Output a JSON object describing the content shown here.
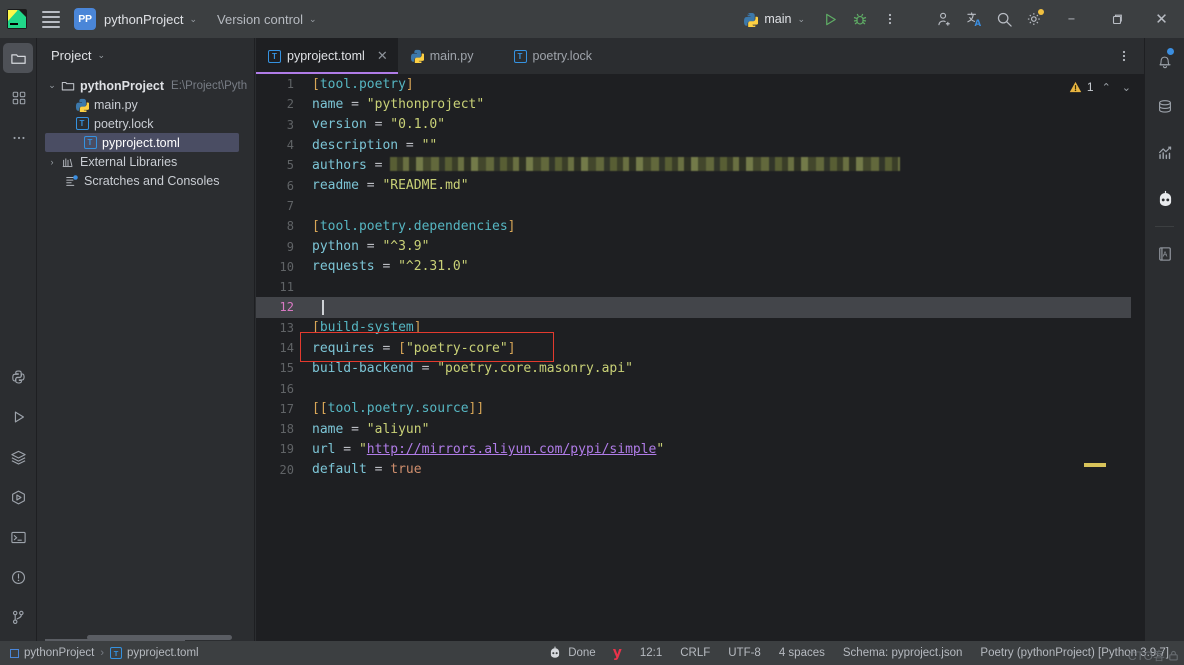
{
  "titlebar": {
    "app_icon": "pycharm-logo-icon",
    "menu_icon": "hamburger-menu-icon",
    "project_badge": "PP",
    "project_name": "pythonProject",
    "project_chevron": "⌄",
    "version_control": "Version control",
    "vcs_chevron": "⌄",
    "run_config": "main",
    "run_config_chevron": "⌄",
    "run_icon": "run-triangle-icon",
    "debug_icon": "debug-bug-icon",
    "more_icon": "more-vertical-icon",
    "account_icon": "add-user-icon",
    "translate_icon": "translate-icon",
    "search_icon": "search-icon",
    "settings_icon": "gear-icon",
    "minimize": "−",
    "maximize": "❐",
    "close": "✕"
  },
  "left_rail": {
    "items": [
      {
        "name": "project-tool-window",
        "icon": "folder-icon",
        "active": true
      },
      {
        "name": "structure-tool-window",
        "icon": "structure-icon",
        "active": false
      },
      {
        "name": "more-tool-windows",
        "icon": "ellipsis-icon",
        "active": false
      }
    ],
    "bottom_items": [
      {
        "name": "python-packages",
        "icon": "python-icon"
      },
      {
        "name": "run-tool-window",
        "icon": "run-triangle-icon"
      },
      {
        "name": "services-tool-window",
        "icon": "layers-icon"
      },
      {
        "name": "python-console",
        "icon": "hexagon-play-icon"
      },
      {
        "name": "terminal-tool-window",
        "icon": "terminal-icon"
      },
      {
        "name": "problems-tool-window",
        "icon": "exclamation-circle-icon"
      },
      {
        "name": "version-control-tool-window",
        "icon": "git-branch-icon"
      }
    ]
  },
  "project_panel": {
    "header": "Project",
    "header_chevron": "⌄",
    "tree": [
      {
        "label": "pythonProject",
        "path": "E:\\Project\\Pyth",
        "icon": "folder-icon",
        "expanded": true,
        "indent": 0,
        "selected": false,
        "bold": true
      },
      {
        "label": "main.py",
        "path": "",
        "icon": "python-file-icon",
        "expanded": null,
        "indent": 1,
        "selected": false,
        "bold": false
      },
      {
        "label": "poetry.lock",
        "path": "",
        "icon": "toml-file-icon",
        "expanded": null,
        "indent": 1,
        "selected": false,
        "bold": false
      },
      {
        "label": "pyproject.toml",
        "path": "",
        "icon": "toml-file-icon",
        "expanded": null,
        "indent": 1,
        "selected": true,
        "bold": false
      },
      {
        "label": "External Libraries",
        "path": "",
        "icon": "library-icon",
        "expanded": false,
        "indent": 0,
        "selected": false,
        "bold": false
      },
      {
        "label": "Scratches and Consoles",
        "path": "",
        "icon": "scratches-icon",
        "expanded": null,
        "indent": 0,
        "selected": false,
        "bold": false
      }
    ]
  },
  "editor": {
    "tabs": [
      {
        "label": "pyproject.toml",
        "icon": "toml-file-icon",
        "active": true,
        "closable": true
      },
      {
        "label": "main.py",
        "icon": "python-file-icon",
        "active": false,
        "closable": false
      },
      {
        "label": "poetry.lock",
        "icon": "toml-file-icon",
        "active": false,
        "closable": false
      }
    ],
    "tab_close_glyph": "✕",
    "tabbar_more_icon": "more-vertical-icon",
    "inspection": {
      "warning_icon": "warning-triangle-icon",
      "warning_count": "1",
      "prev_glyph": "⌃",
      "next_glyph": "⌄"
    },
    "current_line": 12,
    "lines": [
      {
        "num": 1,
        "tokens": [
          {
            "t": "brk",
            "v": "["
          },
          {
            "t": "tbl",
            "v": "tool.poetry"
          },
          {
            "t": "brk",
            "v": "]"
          }
        ]
      },
      {
        "num": 2,
        "tokens": [
          {
            "t": "key",
            "v": "name"
          },
          {
            "t": "op",
            "v": " = "
          },
          {
            "t": "str",
            "v": "\"pythonproject\""
          }
        ]
      },
      {
        "num": 3,
        "tokens": [
          {
            "t": "key",
            "v": "version"
          },
          {
            "t": "op",
            "v": " = "
          },
          {
            "t": "str",
            "v": "\"0.1.0\""
          }
        ]
      },
      {
        "num": 4,
        "tokens": [
          {
            "t": "key",
            "v": "description"
          },
          {
            "t": "op",
            "v": " = "
          },
          {
            "t": "str",
            "v": "\"\""
          }
        ]
      },
      {
        "num": 5,
        "tokens": [
          {
            "t": "key",
            "v": "authors"
          },
          {
            "t": "op",
            "v": " = "
          },
          {
            "t": "redact",
            "v": "",
            "w": "510"
          }
        ]
      },
      {
        "num": 6,
        "tokens": [
          {
            "t": "key",
            "v": "readme"
          },
          {
            "t": "op",
            "v": " = "
          },
          {
            "t": "str",
            "v": "\"README.md\""
          }
        ]
      },
      {
        "num": 7,
        "tokens": []
      },
      {
        "num": 8,
        "tokens": [
          {
            "t": "brk",
            "v": "["
          },
          {
            "t": "tbl",
            "v": "tool.poetry.dependencies"
          },
          {
            "t": "brk",
            "v": "]"
          }
        ]
      },
      {
        "num": 9,
        "tokens": [
          {
            "t": "key",
            "v": "python"
          },
          {
            "t": "op",
            "v": " = "
          },
          {
            "t": "str",
            "v": "\"^3.9\""
          }
        ]
      },
      {
        "num": 10,
        "tokens": [
          {
            "t": "key",
            "v": "requests"
          },
          {
            "t": "op",
            "v": " = "
          },
          {
            "t": "str",
            "v": "\"^2.31.0\""
          }
        ]
      },
      {
        "num": 11,
        "tokens": []
      },
      {
        "num": 12,
        "tokens": []
      },
      {
        "num": 13,
        "tokens": [
          {
            "t": "brk",
            "v": "["
          },
          {
            "t": "tbl",
            "v": "build-system"
          },
          {
            "t": "brk",
            "v": "]"
          }
        ]
      },
      {
        "num": 14,
        "tokens": [
          {
            "t": "key",
            "v": "requires"
          },
          {
            "t": "op",
            "v": " = "
          },
          {
            "t": "brk",
            "v": "["
          },
          {
            "t": "str",
            "v": "\"poetry-core\""
          },
          {
            "t": "brk",
            "v": "]"
          }
        ]
      },
      {
        "num": 15,
        "tokens": [
          {
            "t": "key",
            "v": "build-backend"
          },
          {
            "t": "op",
            "v": " = "
          },
          {
            "t": "str",
            "v": "\"poetry.core.masonry.api\""
          }
        ]
      },
      {
        "num": 16,
        "tokens": []
      },
      {
        "num": 17,
        "tokens": [
          {
            "t": "brk",
            "v": "[["
          },
          {
            "t": "tbl",
            "v": "tool.poetry.source"
          },
          {
            "t": "brk",
            "v": "]]"
          }
        ]
      },
      {
        "num": 18,
        "tokens": [
          {
            "t": "key",
            "v": "name"
          },
          {
            "t": "op",
            "v": " = "
          },
          {
            "t": "str",
            "v": "\"aliyun\""
          }
        ]
      },
      {
        "num": 19,
        "tokens": [
          {
            "t": "key",
            "v": "url"
          },
          {
            "t": "op",
            "v": " = "
          },
          {
            "t": "str",
            "v": "\""
          },
          {
            "t": "url",
            "v": "http://mirrors.aliyun.com/pypi/simple"
          },
          {
            "t": "str",
            "v": "\""
          }
        ]
      },
      {
        "num": 20,
        "tokens": [
          {
            "t": "key",
            "v": "default"
          },
          {
            "t": "op",
            "v": " = "
          },
          {
            "t": "bool",
            "v": "true"
          }
        ]
      }
    ],
    "annotation": {
      "name": "red-highlight-box",
      "color": "#e33a2e",
      "around_lines": [
        10,
        11
      ]
    }
  },
  "right_rail": {
    "items": [
      {
        "name": "notifications",
        "icon": "bell-icon",
        "badge": true
      },
      {
        "name": "database",
        "icon": "database-icon",
        "badge": false
      },
      {
        "name": "profiler",
        "icon": "chart-bar-icon",
        "badge": false
      },
      {
        "name": "ai-assistant",
        "icon": "robot-icon",
        "badge": false
      },
      {
        "name": "translation",
        "icon": "dictionary-icon",
        "badge": false
      }
    ]
  },
  "statusbar": {
    "breadcrumb_project": "pythonProject",
    "breadcrumb_sep": "›",
    "breadcrumb_file": "pyproject.toml",
    "build_icon": "robot-icon",
    "build_status": "Done",
    "y_marker": "у",
    "caret_position": "12:1",
    "line_separator": "CRLF",
    "encoding": "UTF-8",
    "indent": "4 spaces",
    "schema": "Schema: pyproject.json",
    "interpreter": "Poetry (pythonProject) [Python 3.9.7]",
    "watermark": "CTO客",
    "lock_icon": "lock-icon"
  },
  "colors": {
    "accent_tab": "#b07ce8",
    "selection": "#4a4d63",
    "annotation_red": "#e33a2e",
    "string": "#c9d177",
    "table": "#56b6c2",
    "bracket": "#d8a657",
    "key": "#7cc5d6",
    "bool": "#cf8e6d"
  }
}
